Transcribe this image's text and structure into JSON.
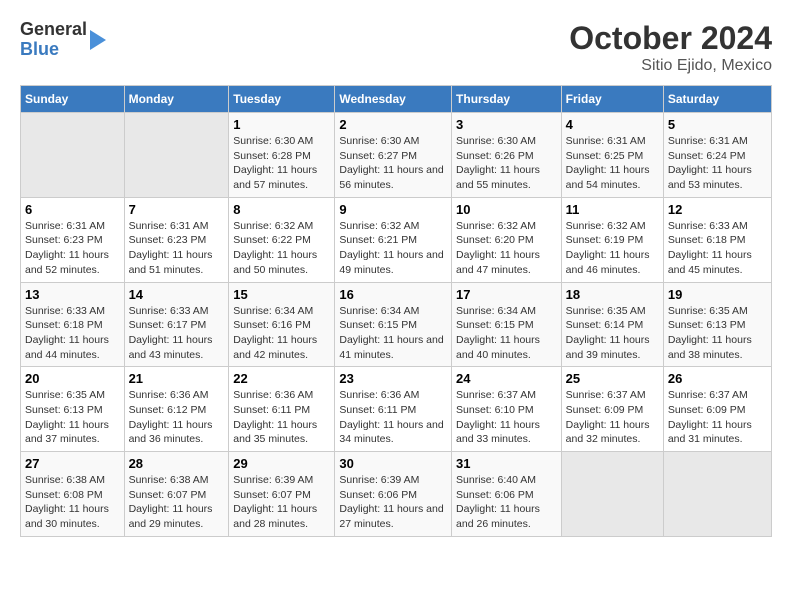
{
  "logo": {
    "line1": "General",
    "line2": "Blue"
  },
  "title": "October 2024",
  "subtitle": "Sitio Ejido, Mexico",
  "days_of_week": [
    "Sunday",
    "Monday",
    "Tuesday",
    "Wednesday",
    "Thursday",
    "Friday",
    "Saturday"
  ],
  "weeks": [
    [
      {
        "day": "",
        "empty": true
      },
      {
        "day": "",
        "empty": true
      },
      {
        "day": "1",
        "sunrise": "6:30 AM",
        "sunset": "6:28 PM",
        "daylight": "11 hours and 57 minutes."
      },
      {
        "day": "2",
        "sunrise": "6:30 AM",
        "sunset": "6:27 PM",
        "daylight": "11 hours and 56 minutes."
      },
      {
        "day": "3",
        "sunrise": "6:30 AM",
        "sunset": "6:26 PM",
        "daylight": "11 hours and 55 minutes."
      },
      {
        "day": "4",
        "sunrise": "6:31 AM",
        "sunset": "6:25 PM",
        "daylight": "11 hours and 54 minutes."
      },
      {
        "day": "5",
        "sunrise": "6:31 AM",
        "sunset": "6:24 PM",
        "daylight": "11 hours and 53 minutes."
      }
    ],
    [
      {
        "day": "6",
        "sunrise": "6:31 AM",
        "sunset": "6:23 PM",
        "daylight": "11 hours and 52 minutes."
      },
      {
        "day": "7",
        "sunrise": "6:31 AM",
        "sunset": "6:23 PM",
        "daylight": "11 hours and 51 minutes."
      },
      {
        "day": "8",
        "sunrise": "6:32 AM",
        "sunset": "6:22 PM",
        "daylight": "11 hours and 50 minutes."
      },
      {
        "day": "9",
        "sunrise": "6:32 AM",
        "sunset": "6:21 PM",
        "daylight": "11 hours and 49 minutes."
      },
      {
        "day": "10",
        "sunrise": "6:32 AM",
        "sunset": "6:20 PM",
        "daylight": "11 hours and 47 minutes."
      },
      {
        "day": "11",
        "sunrise": "6:32 AM",
        "sunset": "6:19 PM",
        "daylight": "11 hours and 46 minutes."
      },
      {
        "day": "12",
        "sunrise": "6:33 AM",
        "sunset": "6:18 PM",
        "daylight": "11 hours and 45 minutes."
      }
    ],
    [
      {
        "day": "13",
        "sunrise": "6:33 AM",
        "sunset": "6:18 PM",
        "daylight": "11 hours and 44 minutes."
      },
      {
        "day": "14",
        "sunrise": "6:33 AM",
        "sunset": "6:17 PM",
        "daylight": "11 hours and 43 minutes."
      },
      {
        "day": "15",
        "sunrise": "6:34 AM",
        "sunset": "6:16 PM",
        "daylight": "11 hours and 42 minutes."
      },
      {
        "day": "16",
        "sunrise": "6:34 AM",
        "sunset": "6:15 PM",
        "daylight": "11 hours and 41 minutes."
      },
      {
        "day": "17",
        "sunrise": "6:34 AM",
        "sunset": "6:15 PM",
        "daylight": "11 hours and 40 minutes."
      },
      {
        "day": "18",
        "sunrise": "6:35 AM",
        "sunset": "6:14 PM",
        "daylight": "11 hours and 39 minutes."
      },
      {
        "day": "19",
        "sunrise": "6:35 AM",
        "sunset": "6:13 PM",
        "daylight": "11 hours and 38 minutes."
      }
    ],
    [
      {
        "day": "20",
        "sunrise": "6:35 AM",
        "sunset": "6:13 PM",
        "daylight": "11 hours and 37 minutes."
      },
      {
        "day": "21",
        "sunrise": "6:36 AM",
        "sunset": "6:12 PM",
        "daylight": "11 hours and 36 minutes."
      },
      {
        "day": "22",
        "sunrise": "6:36 AM",
        "sunset": "6:11 PM",
        "daylight": "11 hours and 35 minutes."
      },
      {
        "day": "23",
        "sunrise": "6:36 AM",
        "sunset": "6:11 PM",
        "daylight": "11 hours and 34 minutes."
      },
      {
        "day": "24",
        "sunrise": "6:37 AM",
        "sunset": "6:10 PM",
        "daylight": "11 hours and 33 minutes."
      },
      {
        "day": "25",
        "sunrise": "6:37 AM",
        "sunset": "6:09 PM",
        "daylight": "11 hours and 32 minutes."
      },
      {
        "day": "26",
        "sunrise": "6:37 AM",
        "sunset": "6:09 PM",
        "daylight": "11 hours and 31 minutes."
      }
    ],
    [
      {
        "day": "27",
        "sunrise": "6:38 AM",
        "sunset": "6:08 PM",
        "daylight": "11 hours and 30 minutes."
      },
      {
        "day": "28",
        "sunrise": "6:38 AM",
        "sunset": "6:07 PM",
        "daylight": "11 hours and 29 minutes."
      },
      {
        "day": "29",
        "sunrise": "6:39 AM",
        "sunset": "6:07 PM",
        "daylight": "11 hours and 28 minutes."
      },
      {
        "day": "30",
        "sunrise": "6:39 AM",
        "sunset": "6:06 PM",
        "daylight": "11 hours and 27 minutes."
      },
      {
        "day": "31",
        "sunrise": "6:40 AM",
        "sunset": "6:06 PM",
        "daylight": "11 hours and 26 minutes."
      },
      {
        "day": "",
        "empty": true
      },
      {
        "day": "",
        "empty": true
      }
    ]
  ],
  "labels": {
    "sunrise": "Sunrise:",
    "sunset": "Sunset:",
    "daylight": "Daylight:"
  }
}
